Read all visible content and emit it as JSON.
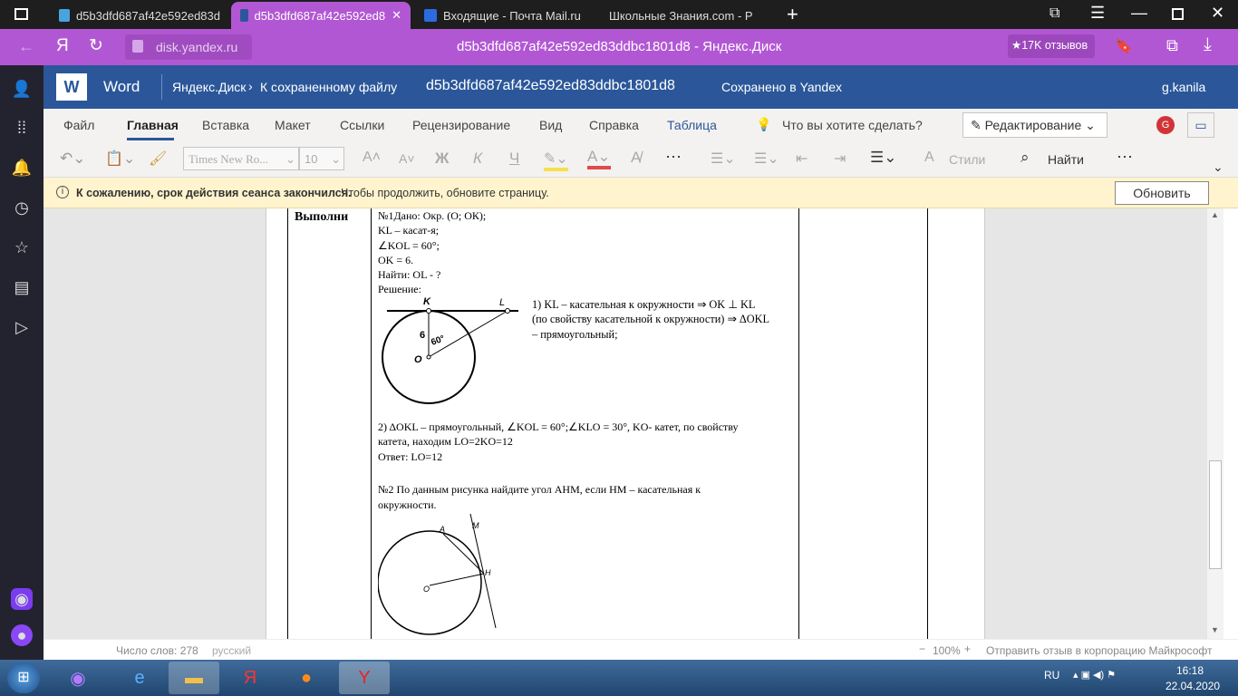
{
  "browser": {
    "tabs": [
      {
        "title": "d5b3dfd687af42e592ed83d"
      },
      {
        "title": "d5b3dfd687af42e592ed8"
      },
      {
        "title": "Входящие - Почта Mail.ru"
      },
      {
        "title": "Школьные Знания.com - Р"
      }
    ],
    "url": "disk.yandex.ru",
    "page_title": "d5b3dfd687af42e592ed83ddbc1801d8",
    "page_title_suffix": "- Яндекс.Диск",
    "reviews": "★17K отзывов",
    "yandex_logo": "Я"
  },
  "word": {
    "app": "Word",
    "breadcrumb1": "Яндекс.Диск",
    "breadcrumb2": "К сохраненному файлу",
    "filename": "d5b3dfd687af42e592ed83ddbc1801d8",
    "saved": "Сохранено в Yandex",
    "user": "g.kanila",
    "avatar": "G",
    "tabs": [
      "Файл",
      "Главная",
      "Вставка",
      "Макет",
      "Ссылки",
      "Рецензирование",
      "Вид",
      "Справка",
      "Таблица"
    ],
    "tell_me": "Что вы хотите сделать?",
    "edit_mode": "Редактирование",
    "font": "Times New Ro...",
    "size": "10",
    "bold": "Ж",
    "italic": "К",
    "underline": "Ч",
    "styles": "Стили",
    "find": "Найти",
    "more": "⋯"
  },
  "warning": {
    "bold": "К сожалению, срок действия сеанса закончился.",
    "text": "Чтобы продолжить, обновите страницу.",
    "button": "Обновить"
  },
  "doc": {
    "cell_label": "Выполни",
    "lines": [
      "№1Дано: Окр. (О; ОК);",
      "KL – касат-я;",
      "∠KOL = 60°;",
      "OK = 6.",
      "Найти: OL - ?",
      "Решение:"
    ],
    "step1": [
      "1) KL – касательная к окружности ⇒ OK ⊥ KL",
      "(по свойству касательной к окружности) ⇒ ΔOKL",
      "– прямоугольный;"
    ],
    "step2": [
      "2) ΔOKL – прямоугольный, ∠KOL = 60°;∠KLO = 30°, KO- катет, по свойству",
      "катета, находим LO=2KO=12",
      "Ответ: LO=12"
    ],
    "task2": [
      "№2 По данным рисунка найдите угол AHM, если HM – касательная к",
      "окружности."
    ],
    "fig1": {
      "K": "K",
      "L": "L",
      "O": "O",
      "six": "6",
      "angle": "60°"
    },
    "fig2": {
      "A": "A",
      "M": "M",
      "H": "H",
      "O": "O"
    }
  },
  "status": {
    "words": "Число слов: 278",
    "lang": "русский",
    "zoom": "100%",
    "feedback": "Отправить отзыв в корпорацию Майкрософт"
  },
  "taskbar": {
    "lang": "RU",
    "time": "16:18",
    "date": "22.04.2020"
  }
}
